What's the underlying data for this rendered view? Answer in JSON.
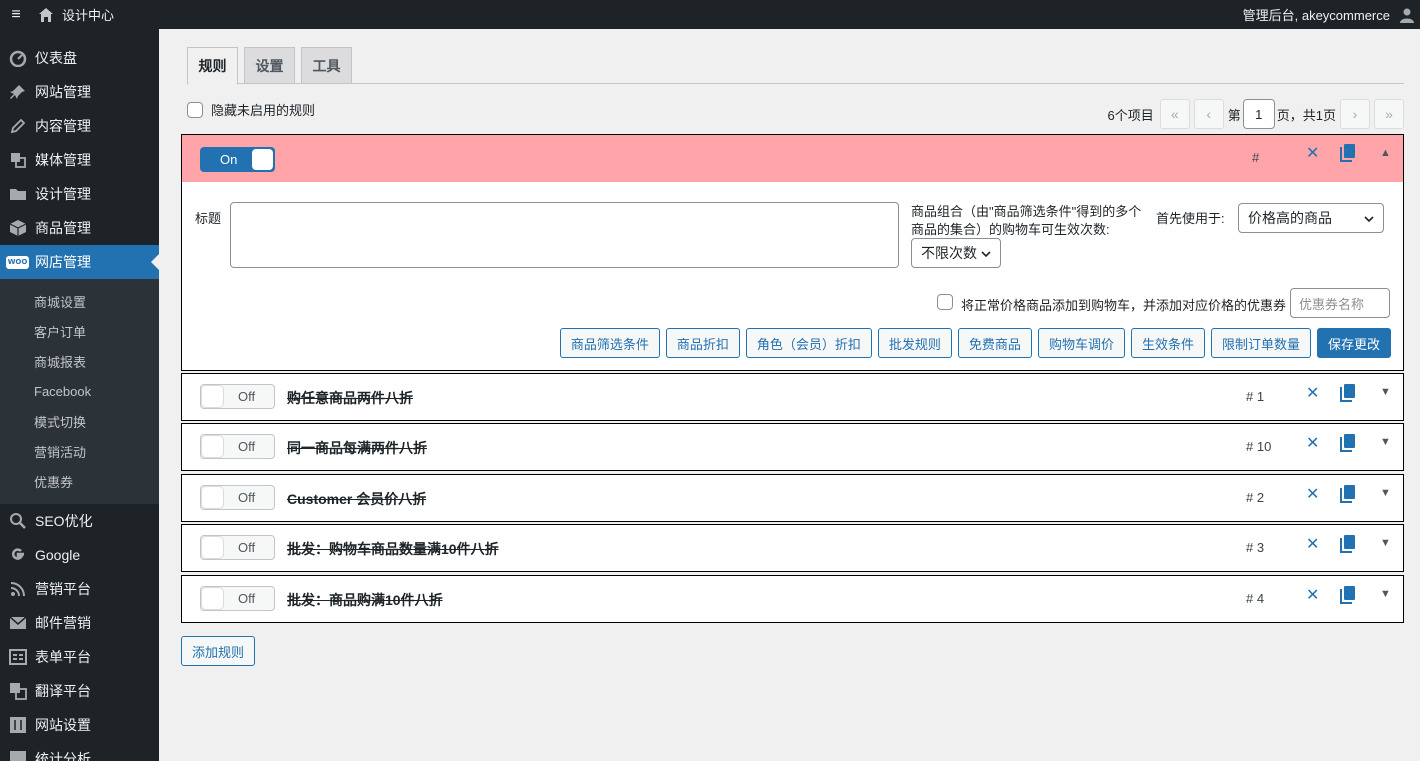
{
  "adminbar": {
    "site_name": "设计中心",
    "howdy": "管理后台, akeycommerce"
  },
  "sidebar": {
    "items_top": [
      {
        "label": "仪表盘",
        "icon": "dashboard-icon"
      },
      {
        "label": "网站管理",
        "icon": "pin-icon"
      },
      {
        "label": "内容管理",
        "icon": "edit-icon"
      },
      {
        "label": "媒体管理",
        "icon": "media-icon"
      },
      {
        "label": "设计管理",
        "icon": "folder-icon"
      },
      {
        "label": "商品管理",
        "icon": "box-icon"
      },
      {
        "label": "网店管理",
        "icon": "woo-icon",
        "badge": "WOO"
      }
    ],
    "submenu": [
      "商城设置",
      "客户订单",
      "商城报表",
      "Facebook",
      "模式切换",
      "营销活动",
      "优惠券"
    ],
    "items_bottom": [
      {
        "label": "SEO优化",
        "icon": "search-icon"
      },
      {
        "label": "Google",
        "icon": "google-icon"
      },
      {
        "label": "营销平台",
        "icon": "rss-icon"
      },
      {
        "label": "邮件营销",
        "icon": "mail-icon"
      },
      {
        "label": "表单平台",
        "icon": "form-icon"
      },
      {
        "label": "翻译平台",
        "icon": "translate-icon"
      },
      {
        "label": "网站设置",
        "icon": "settings-icon"
      },
      {
        "label": "统计分析",
        "icon": "chart-icon"
      }
    ]
  },
  "tabs": [
    "规则",
    "设置",
    "工具"
  ],
  "filters": {
    "hide_disabled_label": "隐藏未启用的规则"
  },
  "pagination": {
    "count": "6个项目",
    "first": "«",
    "prev": "‹",
    "page_prefix": "第",
    "current": "1",
    "page_suffix": "页，共1页",
    "next": "›",
    "last": "»"
  },
  "rule_editor": {
    "toggle": "On",
    "num": "#",
    "title_label": "标题",
    "combo_label": "商品组合（由\"商品筛选条件\"得到的多个商品的集合）的购物车可生效次数:",
    "combo_value": "不限次数",
    "priority_label": "首先使用于:",
    "priority_value": "价格高的商品",
    "coupon_label": "将正常价格商品添加到购物车，并添加对应价格的优惠券",
    "coupon_placeholder": "优惠券名称",
    "buttons": [
      "商品筛选条件",
      "商品折扣",
      "角色（会员）折扣",
      "批发规则",
      "免费商品",
      "购物车调价",
      "生效条件",
      "限制订单数量"
    ],
    "save": "保存更改"
  },
  "rules": [
    {
      "toggle": "Off",
      "title": "购任意商品两件八折",
      "num": "# 1"
    },
    {
      "toggle": "Off",
      "title": "同一商品每满两件八折",
      "num": "# 10"
    },
    {
      "toggle": "Off",
      "title": "Customer 会员价八折",
      "num": "# 2"
    },
    {
      "toggle": "Off",
      "title": "批发：购物车商品数量满10件八折",
      "num": "# 3"
    },
    {
      "toggle": "Off",
      "title": "批发：商品购满10件八折",
      "num": "# 4"
    }
  ],
  "add_rule": "添加规则",
  "colors": {
    "accent": "#2271b1",
    "editing_header": "#ffa4a8",
    "sidebar": "#1d2327"
  }
}
